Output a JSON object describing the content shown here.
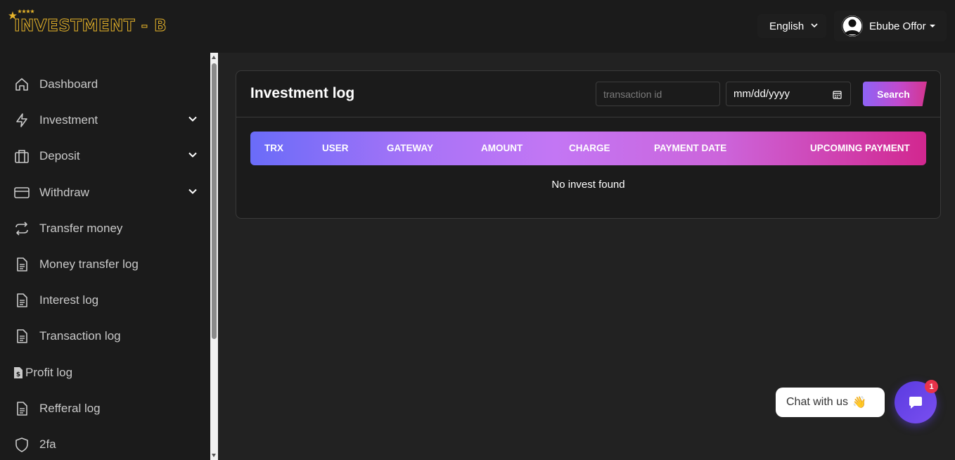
{
  "brand": {
    "logo_text": "INVESTMENT - B"
  },
  "header": {
    "language": "English",
    "user_name": "Ebube Offor"
  },
  "sidebar": {
    "items": [
      {
        "label": "Dashboard",
        "icon": "home-icon",
        "has_dropdown": false
      },
      {
        "label": "Investment",
        "icon": "lightning-icon",
        "has_dropdown": true
      },
      {
        "label": "Deposit",
        "icon": "briefcase-icon",
        "has_dropdown": true
      },
      {
        "label": "Withdraw",
        "icon": "credit-card-icon",
        "has_dropdown": true
      },
      {
        "label": "Transfer money",
        "icon": "transfer-icon",
        "has_dropdown": false
      },
      {
        "label": "Money transfer log",
        "icon": "document-icon",
        "has_dropdown": false
      },
      {
        "label": "Interest log",
        "icon": "document-icon",
        "has_dropdown": false
      },
      {
        "label": "Transaction log",
        "icon": "document-icon",
        "has_dropdown": false
      },
      {
        "label": "Profit log",
        "icon": "invoice-icon",
        "has_dropdown": false
      },
      {
        "label": "Refferal log",
        "icon": "document-icon",
        "has_dropdown": false
      },
      {
        "label": "2fa",
        "icon": "shield-icon",
        "has_dropdown": false
      }
    ]
  },
  "main": {
    "title": "Investment log",
    "search": {
      "transaction_placeholder": "transaction id",
      "date_placeholder": "mm/dd/yyyy",
      "button_label": "Search"
    },
    "table": {
      "columns": [
        "TRX",
        "USER",
        "GATEWAY",
        "AMOUNT",
        "CHARGE",
        "PAYMENT DATE",
        "UPCOMING PAYMENT"
      ],
      "empty_message": "No invest found"
    }
  },
  "chat": {
    "label": "Chat with us",
    "emoji": "👋",
    "badge_count": "1"
  },
  "colors": {
    "page_bg": "#222222",
    "panel_bg": "#1b1b1b",
    "accent_start": "#6a6cf8",
    "accent_end": "#d2278f",
    "logo_gold": "#e8b52a"
  }
}
